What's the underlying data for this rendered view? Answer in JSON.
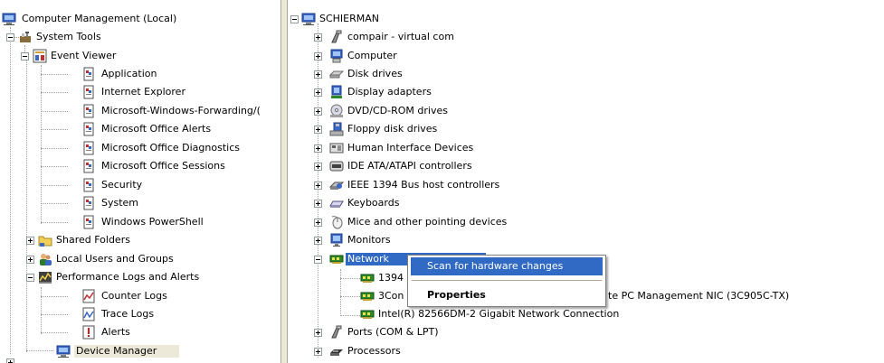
{
  "left_tree": {
    "root": {
      "label": "Computer Management (Local)",
      "icon": "computer-icon"
    },
    "system_tools": {
      "label": "System Tools",
      "icon": "tools-icon"
    },
    "event_viewer": {
      "label": "Event Viewer",
      "icon": "event-viewer-icon"
    },
    "event_logs": [
      {
        "label": "Application",
        "icon": "log-icon"
      },
      {
        "label": "Internet Explorer",
        "icon": "log-icon"
      },
      {
        "label": "Microsoft-Windows-Forwarding/(",
        "icon": "log-icon"
      },
      {
        "label": "Microsoft Office Alerts",
        "icon": "log-icon"
      },
      {
        "label": "Microsoft Office Diagnostics",
        "icon": "log-icon"
      },
      {
        "label": "Microsoft Office Sessions",
        "icon": "log-icon"
      },
      {
        "label": "Security",
        "icon": "log-icon"
      },
      {
        "label": "System",
        "icon": "log-icon"
      },
      {
        "label": "Windows PowerShell",
        "icon": "log-icon"
      }
    ],
    "shared_folders": {
      "label": "Shared Folders",
      "icon": "shared-folder-icon"
    },
    "local_users": {
      "label": "Local Users and Groups",
      "icon": "users-icon"
    },
    "perf_logs": {
      "label": "Performance Logs and Alerts",
      "icon": "performance-icon"
    },
    "perf_items": [
      {
        "label": "Counter Logs",
        "icon": "counter-log-icon"
      },
      {
        "label": "Trace Logs",
        "icon": "trace-log-icon"
      },
      {
        "label": "Alerts",
        "icon": "alert-icon"
      }
    ],
    "device_manager": {
      "label": "Device Manager",
      "icon": "device-manager-icon"
    }
  },
  "right_tree": {
    "root": {
      "label": "SCHIERMAN",
      "icon": "computer-icon"
    },
    "categories": [
      {
        "label": "compair - virtual com",
        "icon": "port-icon"
      },
      {
        "label": "Computer",
        "icon": "computer-category-icon"
      },
      {
        "label": "Disk drives",
        "icon": "disk-drive-icon"
      },
      {
        "label": "Display adapters",
        "icon": "display-adapter-icon"
      },
      {
        "label": "DVD/CD-ROM drives",
        "icon": "dvd-drive-icon"
      },
      {
        "label": "Floppy disk drives",
        "icon": "floppy-drive-icon"
      },
      {
        "label": "Human Interface Devices",
        "icon": "hid-icon"
      },
      {
        "label": "IDE ATA/ATAPI controllers",
        "icon": "ide-controller-icon"
      },
      {
        "label": "IEEE 1394 Bus host controllers",
        "icon": "ieee1394-icon"
      },
      {
        "label": "Keyboards",
        "icon": "keyboard-icon"
      },
      {
        "label": "Mice and other pointing devices",
        "icon": "mouse-icon"
      },
      {
        "label": "Monitors",
        "icon": "monitor-icon"
      }
    ],
    "network": {
      "label": "Network",
      "icon": "network-card-icon"
    },
    "network_devices": [
      {
        "label": "1394",
        "icon": "network-card-icon"
      },
      {
        "label": "3Con",
        "label_tail": "te PC Management NIC (3C905C-TX)",
        "icon": "network-card-icon"
      },
      {
        "label": "Intel(R) 82566DM-2 Gigabit Network Connection",
        "icon": "network-card-icon"
      }
    ],
    "after": [
      {
        "label": "Ports (COM & LPT)",
        "icon": "port-icon"
      },
      {
        "label": "Processors",
        "icon": "processor-icon"
      }
    ]
  },
  "context_menu": {
    "scan": "Scan for hardware changes",
    "properties": "Properties"
  },
  "colors": {
    "selection": "#316ac5",
    "splitter": "#ece9d8"
  }
}
